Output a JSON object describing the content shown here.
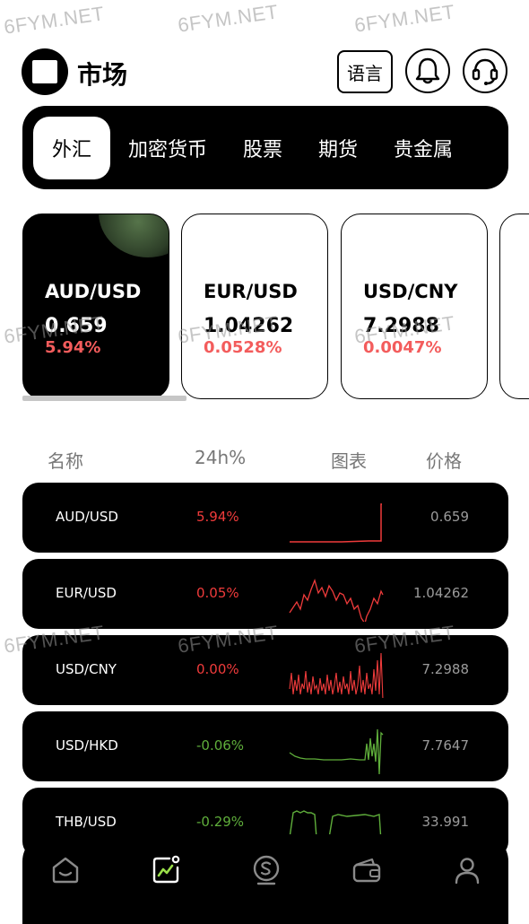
{
  "watermark": "6FYM.NET",
  "header": {
    "title": "市场",
    "language_label": "语言"
  },
  "tabs": [
    {
      "label": "外汇",
      "active": true
    },
    {
      "label": "加密货币"
    },
    {
      "label": "股票"
    },
    {
      "label": "期货"
    },
    {
      "label": "贵金属"
    }
  ],
  "cards": [
    {
      "pair": "AUD/USD",
      "price": "0.659",
      "change": "5.94%"
    },
    {
      "pair": "EUR/USD",
      "price": "1.04262",
      "change": "0.0528%"
    },
    {
      "pair": "USD/CNY",
      "price": "7.2988",
      "change": "0.0047%"
    }
  ],
  "list": {
    "columns": {
      "name": "名称",
      "change": "24h%",
      "chart": "图表",
      "price": "价格"
    },
    "rows": [
      {
        "pair": "AUD/USD",
        "change": "5.94%",
        "price": "0.659",
        "trend": "up"
      },
      {
        "pair": "EUR/USD",
        "change": "0.05%",
        "price": "1.04262",
        "trend": "up"
      },
      {
        "pair": "USD/CNY",
        "change": "0.00%",
        "price": "7.2988",
        "trend": "up"
      },
      {
        "pair": "USD/HKD",
        "change": "-0.06%",
        "price": "7.7647",
        "trend": "down"
      },
      {
        "pair": "THB/USD",
        "change": "-0.29%",
        "price": "33.991",
        "trend": "down"
      }
    ]
  },
  "bottom_nav": [
    {
      "icon": "home-icon",
      "active": false
    },
    {
      "icon": "market-icon",
      "active": true
    },
    {
      "icon": "trade-icon",
      "active": false
    },
    {
      "icon": "wallet-icon",
      "active": false
    },
    {
      "icon": "profile-icon",
      "active": false
    }
  ],
  "colors": {
    "up": "#ef3b3b",
    "down": "#5fae3b",
    "card_change": "#f35c5c",
    "background": "#ffffff",
    "panel": "#000000"
  }
}
